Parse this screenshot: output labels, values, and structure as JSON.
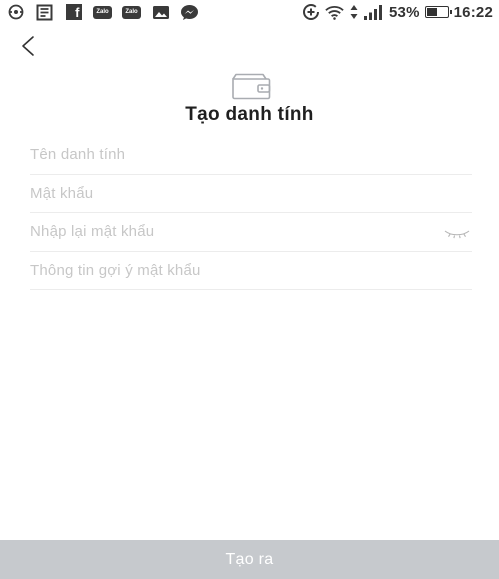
{
  "statusbar": {
    "zalo_label_1": "Zalo",
    "zalo_label_2": "Zalo",
    "facebook_label": "f",
    "battery_percent_text": "53%",
    "battery_level": 0.53,
    "time": "16:22",
    "icons": [
      "vpn-icon",
      "news-icon",
      "facebook-icon",
      "zalo-icon",
      "zalo-icon",
      "gallery-icon",
      "messenger-icon",
      "data-saver-icon",
      "wifi-icon",
      "data-transfer-icon",
      "signal-icon",
      "battery-icon"
    ]
  },
  "header": {
    "back_icon": "chevron-left-icon",
    "logo_icon": "wallet-icon",
    "title": "Tạo danh tính"
  },
  "form": {
    "identity_name": {
      "value": "",
      "placeholder": "Tên danh tính"
    },
    "password": {
      "value": "",
      "placeholder": "Mật khẩu"
    },
    "confirm_password": {
      "value": "",
      "placeholder": "Nhập lại mật khẩu",
      "toggle_icon": "eye-closed-icon"
    },
    "password_hint": {
      "value": "",
      "placeholder": "Thông tin gợi ý mật khẩu"
    }
  },
  "submit": {
    "label": "Tạo ra",
    "background_color": "#c6c9cd"
  }
}
